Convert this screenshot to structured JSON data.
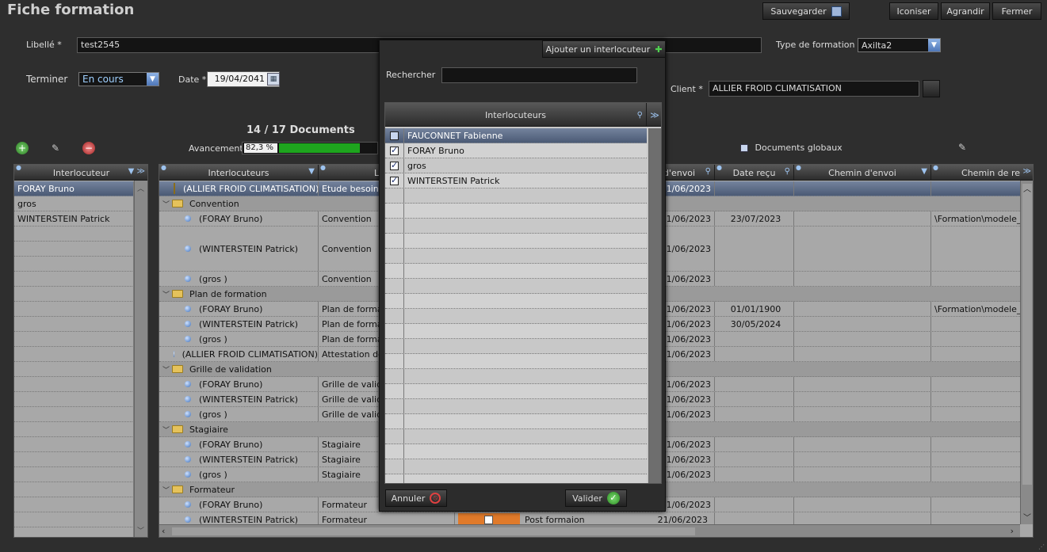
{
  "window": {
    "title": "Fiche formation",
    "buttons": {
      "save": "Sauvegarder",
      "iconify": "Iconiser",
      "maximize": "Agrandir",
      "close": "Fermer"
    }
  },
  "form": {
    "libelle_label": "Libellé *",
    "libelle_value": "test2545",
    "type_label": "Type de formation *",
    "type_value": "Axilta2",
    "terminer_label": "Terminer",
    "terminer_value": "En cours",
    "date_label": "Date *",
    "date_value": "19/04/2041",
    "client_label": "Client *",
    "client_value": "ALLIER FROID CLIMATISATION"
  },
  "documents": {
    "count_label": "14 / 17 Documents",
    "progress_label": "Avancement",
    "progress_text": "82,3 %",
    "progress": 0.823,
    "global_docs_label": "Documents globaux"
  },
  "left_grid": {
    "header": "Interlocuteur",
    "rows": [
      "FORAY Bruno",
      "gros",
      "WINTERSTEIN Patrick"
    ]
  },
  "main_grid": {
    "headers": {
      "interlocuteurs": "Interlocuteurs",
      "libelle": "L",
      "date_envoi": "d'envoi",
      "date_recu": "Date reçu",
      "chemin_envoi": "Chemin d'envoi",
      "chemin_recu": "Chemin de re"
    },
    "rows": [
      {
        "kind": "top",
        "who": "(ALLIER FROID CLIMATISATION)",
        "doc": "Etude besoin c",
        "envoi": "1/06/2023",
        "recu": "",
        "chemin": ""
      },
      {
        "kind": "group",
        "who": "Convention"
      },
      {
        "kind": "item",
        "who": "(FORAY Bruno)",
        "doc": "Convention",
        "envoi": "1/06/2023",
        "recu": "23/07/2023",
        "chemin": "\\Formation\\modele_d"
      },
      {
        "kind": "tall",
        "who": "(WINTERSTEIN Patrick)",
        "doc": "Convention",
        "envoi": "1/06/2023",
        "recu": "",
        "chemin": ""
      },
      {
        "kind": "item",
        "who": "(gros )",
        "doc": "Convention",
        "envoi": "1/06/2023",
        "recu": "",
        "chemin": ""
      },
      {
        "kind": "group",
        "who": "Plan de formation"
      },
      {
        "kind": "item",
        "who": "(FORAY Bruno)",
        "doc": "Plan de format",
        "envoi": "1/06/2023",
        "recu": "01/01/1900",
        "chemin": "\\Formation\\modele_d"
      },
      {
        "kind": "item",
        "who": "(WINTERSTEIN Patrick)",
        "doc": "Plan de format",
        "envoi": "1/06/2023",
        "recu": "30/05/2024",
        "chemin": ""
      },
      {
        "kind": "item",
        "who": "(gros )",
        "doc": "Plan de format",
        "envoi": "1/06/2023",
        "recu": "",
        "chemin": ""
      },
      {
        "kind": "top2",
        "who": "(ALLIER FROID CLIMATISATION)",
        "doc": "Attestation de",
        "envoi": "1/06/2023",
        "recu": "",
        "chemin": ""
      },
      {
        "kind": "group",
        "who": "Grille de validation"
      },
      {
        "kind": "item",
        "who": "(FORAY Bruno)",
        "doc": "Grille de valida",
        "envoi": "1/06/2023",
        "recu": "",
        "chemin": ""
      },
      {
        "kind": "item",
        "who": "(WINTERSTEIN Patrick)",
        "doc": "Grille de valida",
        "envoi": "1/06/2023",
        "recu": "",
        "chemin": ""
      },
      {
        "kind": "item",
        "who": "(gros )",
        "doc": "Grille de valida",
        "envoi": "1/06/2023",
        "recu": "",
        "chemin": ""
      },
      {
        "kind": "group",
        "who": "Stagiaire"
      },
      {
        "kind": "item",
        "who": "(FORAY Bruno)",
        "doc": "Stagiaire",
        "envoi": "1/06/2023",
        "recu": "",
        "chemin": ""
      },
      {
        "kind": "item",
        "who": "(WINTERSTEIN Patrick)",
        "doc": "Stagiaire",
        "envoi": "1/06/2023",
        "recu": "",
        "chemin": ""
      },
      {
        "kind": "item",
        "who": "(gros )",
        "doc": "Stagiaire",
        "envoi": "1/06/2023",
        "recu": "",
        "chemin": ""
      },
      {
        "kind": "group",
        "who": "Formateur"
      },
      {
        "kind": "item",
        "who": "(FORAY Bruno)",
        "doc": "Formateur",
        "envoi": "1/06/2023",
        "recu": "",
        "chemin": ""
      },
      {
        "kind": "last",
        "who": "(WINTERSTEIN Patrick)",
        "doc": "Formateur",
        "envoi": "21/06/2023",
        "recu": "",
        "chemin": "",
        "extra": "Post formaion"
      }
    ]
  },
  "modal": {
    "add_button": "Ajouter un interlocuteur",
    "search_label": "Rechercher",
    "search_value": "",
    "list_header": "Interlocuteurs",
    "items": [
      {
        "name": "FAUCONNET Fabienne",
        "checked": false
      },
      {
        "name": "FORAY Bruno",
        "checked": true
      },
      {
        "name": "gros",
        "checked": true
      },
      {
        "name": "WINTERSTEIN Patrick",
        "checked": true
      }
    ],
    "cancel": "Annuler",
    "validate": "Valider"
  },
  "colors": {
    "accent": "#4f77b8",
    "progress": "#1ea51e",
    "selected": "#5b6a85"
  }
}
